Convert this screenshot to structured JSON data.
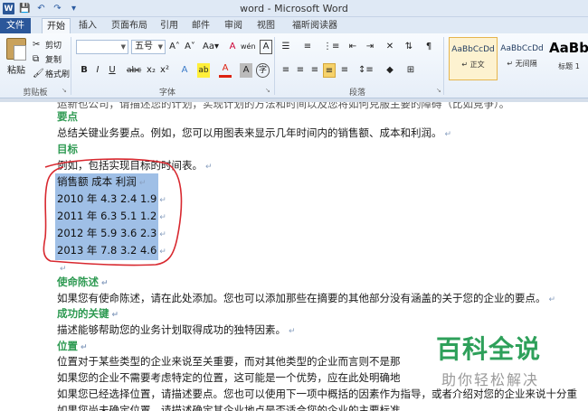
{
  "window": {
    "title": "word - Microsoft Word"
  },
  "qat": {
    "logo": "W",
    "save": "💾",
    "undo": "↶",
    "redo": "↷",
    "customize": "▾"
  },
  "tabs": [
    {
      "label": "文件"
    },
    {
      "label": "开始"
    },
    {
      "label": "插入"
    },
    {
      "label": "页面布局"
    },
    {
      "label": "引用"
    },
    {
      "label": "邮件"
    },
    {
      "label": "审阅"
    },
    {
      "label": "视图"
    },
    {
      "label": "福昕阅读器"
    }
  ],
  "clipboard": {
    "paste": "粘贴",
    "cut": "剪切",
    "copy": "复制",
    "format_painter": "格式刷",
    "group_label": "剪贴板"
  },
  "font": {
    "font_name": "",
    "font_size": "五号",
    "group_label": "字体",
    "grow": "A˄",
    "shrink": "A˅",
    "change_case": "Aa▾",
    "clear_format": "A",
    "phonetic": "wén",
    "char_border": "A",
    "bold": "B",
    "italic": "I",
    "underline": "U",
    "strikethrough": "abc",
    "subscript": "x₂",
    "superscript": "x²",
    "text_effects": "A",
    "highlight": "ab",
    "font_color": "A",
    "char_shading": "A",
    "enclose": "字"
  },
  "paragraph": {
    "group_label": "段落"
  },
  "styles": [
    {
      "sample": "AaBbCcDd",
      "name": "↵ 正文"
    },
    {
      "sample": "AaBbCcDd",
      "name": "↵ 无间隔"
    },
    {
      "sample": "AaBb",
      "name": "标题 1"
    }
  ],
  "document": {
    "cut_line": "运新也公司，请描述您的计划，实现计划的方法和时间以及您将如何克服主要的障碍（比如竞争）。",
    "lines": [
      {
        "text": "要点",
        "heading": true
      },
      {
        "text": "总结关键业务要点。例如，您可以用图表来显示几年时间内的销售额、成本和利润。",
        "heading": false
      },
      {
        "text": "目标",
        "heading": true
      },
      {
        "text": "例如，包括实现目标的时间表。",
        "heading": false
      }
    ],
    "table_lines": [
      "销售额  成本  利润",
      "2010 年  4.3 2.4 1.9",
      "2011 年  6.3 5.1 1.2",
      "2012 年  5.9 3.6 2.3",
      "2013 年  7.8 3.2 4.6"
    ],
    "after_lines": [
      {
        "text": "",
        "heading": false
      },
      {
        "text": "使命陈述",
        "heading": true
      },
      {
        "text": "如果您有使命陈述，请在此处添加。您也可以添加那些在摘要的其他部分没有涵盖的关于您的企业的要点。",
        "heading": false
      },
      {
        "text": "成功的关键",
        "heading": true
      },
      {
        "text": "描述能够帮助您的业务计划取得成功的独特因素。",
        "heading": false
      },
      {
        "text": "位置",
        "heading": true
      },
      {
        "text": "位置对于某些类型的企业来说至关重要，而对其他类型的企业而言则不是那",
        "heading": false
      },
      {
        "text": "如果您的企业不需要考虑特定的位置，这可能是一个优势，应在此处明确地",
        "heading": false
      },
      {
        "text": "如果您已经选择位置，请描述要点。您也可以使用下一项中概括的因素作为指导，或者介绍对您的企业来说十分重",
        "heading": false
      },
      {
        "text": "如果您尚未确定位置，请描述确定其企业地点是否适合您的企业的主要标准。",
        "heading": false
      }
    ],
    "para_mark": "↵"
  },
  "watermark": {
    "title": "百科全说",
    "subtitle": "助你轻松解决"
  }
}
